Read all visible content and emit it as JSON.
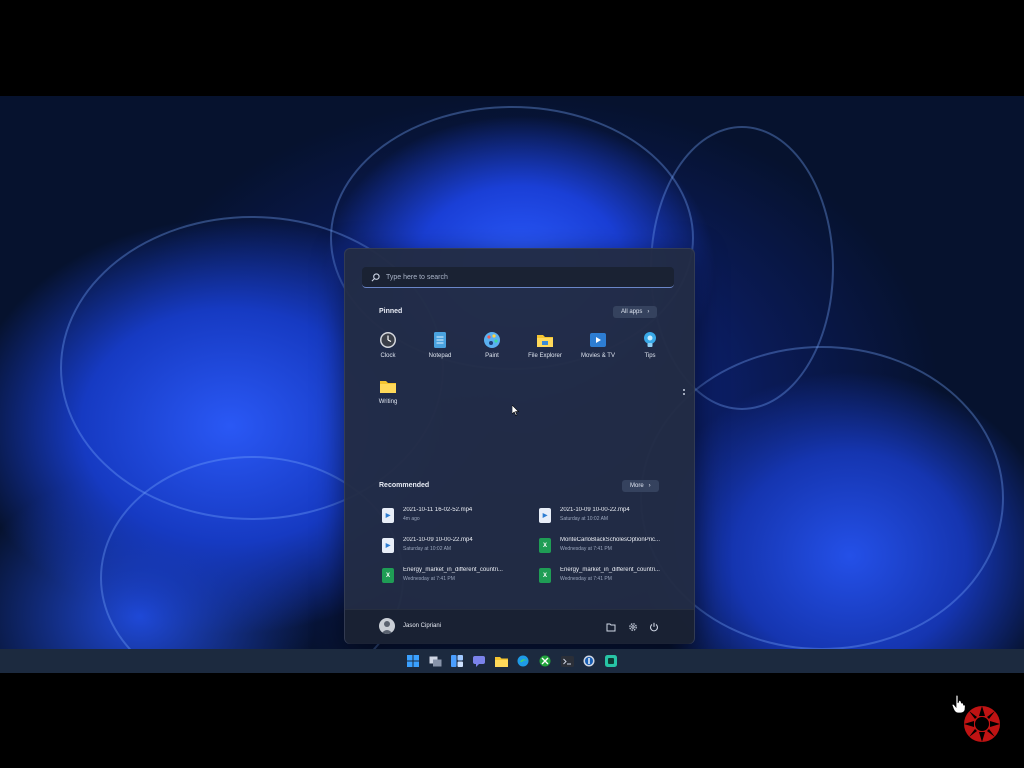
{
  "search": {
    "placeholder": "Type here to search"
  },
  "pinned": {
    "title": "Pinned",
    "all_apps_label": "All apps",
    "apps": [
      {
        "label": "Clock",
        "icon": "clock-icon",
        "color": "#c8cbd0"
      },
      {
        "label": "Notepad",
        "icon": "notepad-icon",
        "color": "#4aa3e0"
      },
      {
        "label": "Paint",
        "icon": "paint-icon",
        "color": "#5ab0f0"
      },
      {
        "label": "File Explorer",
        "icon": "folder-icon",
        "color": "#f4c430"
      },
      {
        "label": "Movies & TV",
        "icon": "movies-icon",
        "color": "#2d7dd2"
      },
      {
        "label": "Tips",
        "icon": "tips-icon",
        "color": "#39a9e8"
      },
      {
        "label": "Writing",
        "icon": "folder-icon",
        "color": "#f4c430"
      }
    ]
  },
  "recommended": {
    "title": "Recommended",
    "more_label": "More",
    "items": [
      {
        "name": "2021-10-11 16-02-52.mp4",
        "time": "4m ago",
        "icon": "video-file-icon"
      },
      {
        "name": "2021-10-09 10-00-22.mp4",
        "time": "Saturday at 10:02 AM",
        "icon": "video-file-icon"
      },
      {
        "name": "2021-10-09 10-00-22.mp4",
        "time": "Saturday at 10:02 AM",
        "icon": "video-file-icon"
      },
      {
        "name": "MonteCarloBlackScholesOptionPric...",
        "time": "Wednesday at 7:41 PM",
        "icon": "excel-file-icon"
      },
      {
        "name": "Energy_market_in_different_countri...",
        "time": "Wednesday at 7:41 PM",
        "icon": "excel-file-icon"
      },
      {
        "name": "Energy_market_in_different_countri...",
        "time": "Wednesday at 7:41 PM",
        "icon": "excel-file-icon"
      }
    ]
  },
  "user": {
    "name": "Jason Cipriani"
  },
  "colors": {
    "accent": "#2c5cff",
    "menu_bg": "#222c44",
    "taskbar_bg": "#1c2a3f"
  }
}
